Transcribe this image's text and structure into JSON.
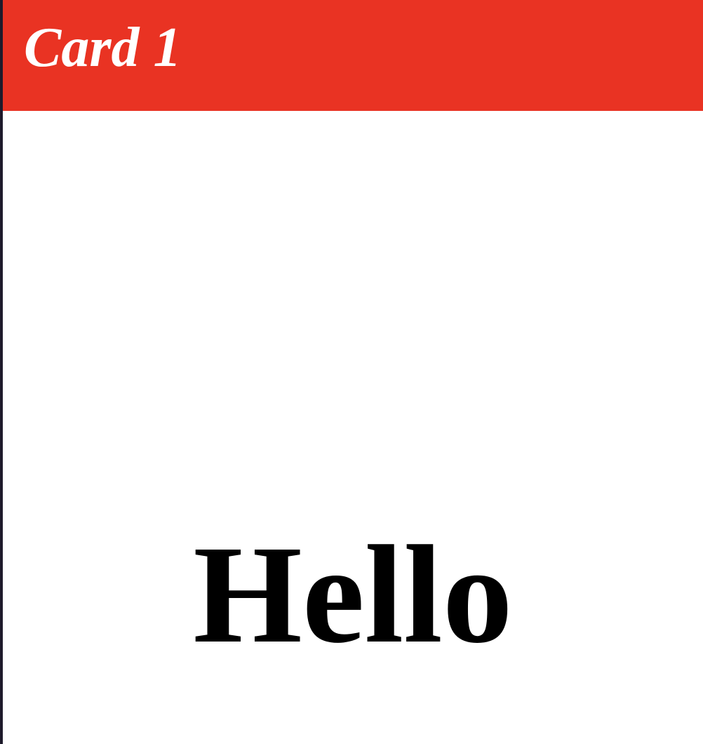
{
  "card": {
    "title": "Card 1",
    "message": "Hello"
  },
  "colors": {
    "header_background": "#e93323",
    "card_background": "#ffffff",
    "title_text": "#ffffff",
    "message_text": "#000000",
    "page_background": "#1e1a2b"
  }
}
